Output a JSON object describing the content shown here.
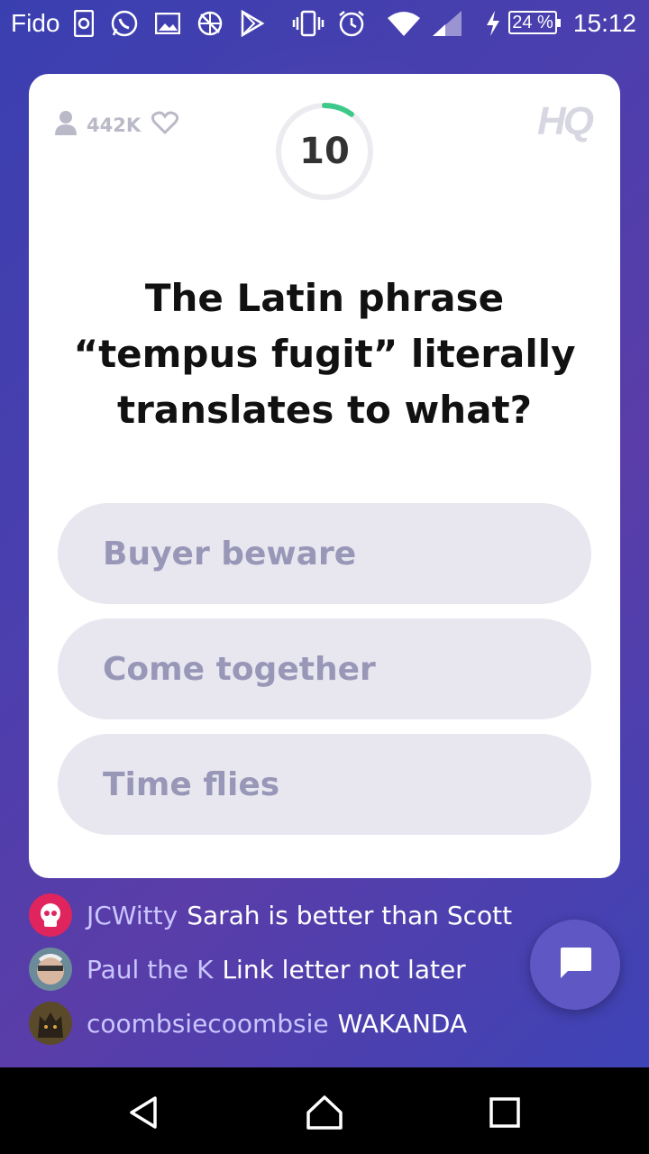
{
  "status_bar": {
    "carrier": "Fido",
    "battery": "24 %",
    "time": "15:12",
    "icons": [
      "sync-icon",
      "whatsapp-icon",
      "image-icon",
      "no-data-icon",
      "play-store-icon",
      "vibrate-icon",
      "alarm-icon",
      "wifi-icon",
      "signal-icon",
      "charging-icon",
      "battery-icon"
    ]
  },
  "card": {
    "viewer_count": "442K",
    "logo": "HQ",
    "timer": "10",
    "timer_progress": 0.1,
    "question": "The Latin phrase “tempus fugit” literally translates to what?",
    "answers": [
      "Buyer beware",
      "Come together",
      "Time flies"
    ]
  },
  "chat": [
    {
      "user": "JCWitty",
      "message": "Sarah is better than Scott",
      "avatar_color": "#e0245e"
    },
    {
      "user": "Paul the K",
      "message": "Link letter not later",
      "avatar_color": "#6b8a9a"
    },
    {
      "user": "coombsiecoombsie",
      "message": "WAKANDA",
      "avatar_color": "#5a4a2a"
    }
  ],
  "colors": {
    "accent_green": "#3ec98a",
    "answer_bg": "#e8e7ef",
    "answer_text": "#9897b8",
    "chat_username": "#c9c6ff"
  }
}
